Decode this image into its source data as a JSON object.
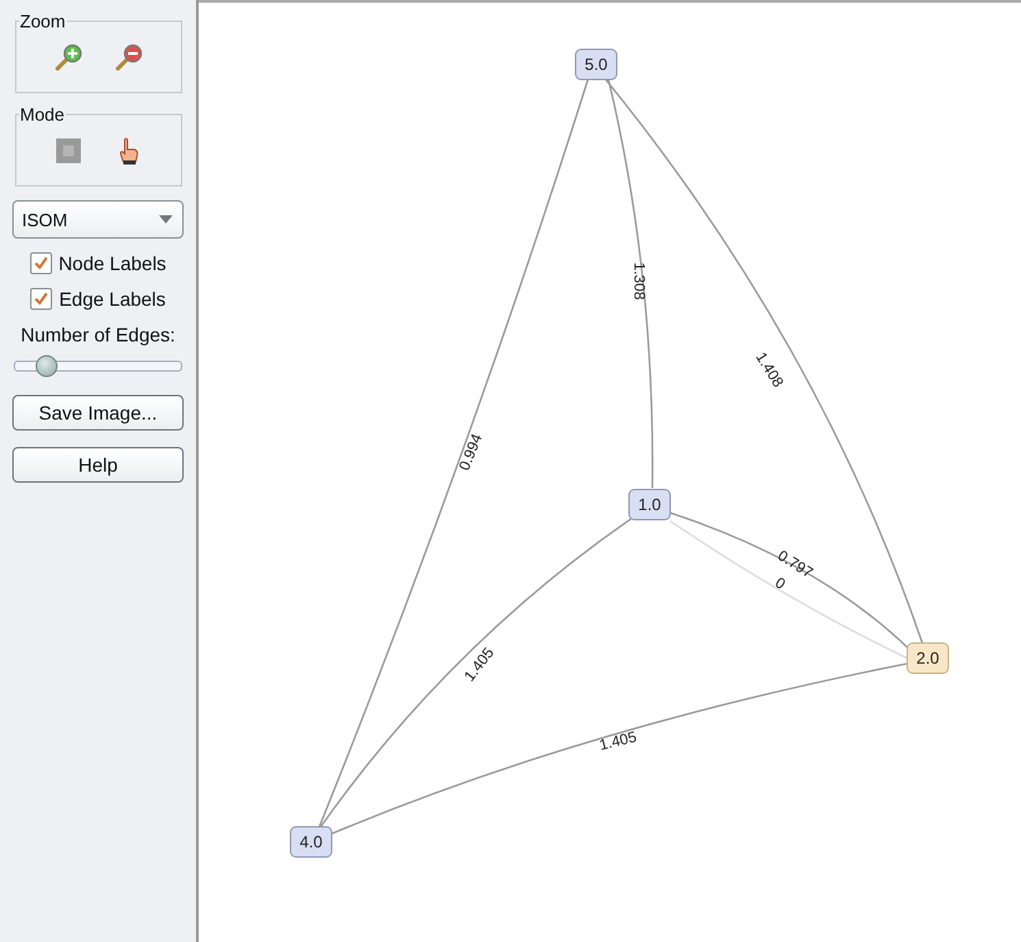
{
  "sidebar": {
    "zoom_group": {
      "title": "Zoom"
    },
    "mode_group": {
      "title": "Mode"
    },
    "layout_select": {
      "value": "ISOM"
    },
    "checkboxes": [
      {
        "label": "Node Labels",
        "checked": true
      },
      {
        "label": "Edge Labels",
        "checked": true
      }
    ],
    "edges_slider": {
      "label": "Number of Edges:",
      "level": 0.15
    },
    "buttons": [
      "Save Image...",
      "Help"
    ]
  },
  "graph": {
    "nodes": [
      {
        "label": "5.0",
        "selected": false
      },
      {
        "label": "1.0",
        "selected": false
      },
      {
        "label": "2.0",
        "selected": true
      },
      {
        "label": "4.0",
        "selected": false
      }
    ],
    "edges": [
      {
        "label": "0.994"
      },
      {
        "label": "1.308"
      },
      {
        "label": "1.408"
      },
      {
        "label": "0.797"
      },
      {
        "label": "0"
      },
      {
        "label": "1.405"
      },
      {
        "label": "1.405"
      }
    ]
  }
}
